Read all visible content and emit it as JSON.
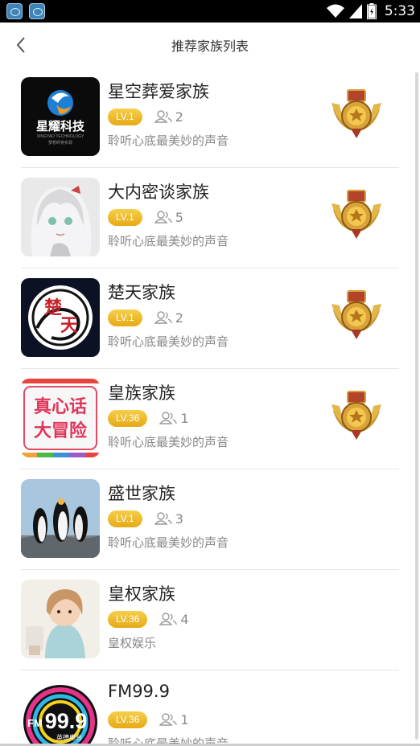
{
  "status": {
    "time": "5:33",
    "icons": [
      "app-icon",
      "app-icon",
      "wifi-icon",
      "signal-icon",
      "battery-icon"
    ]
  },
  "header": {
    "title": "推荐家族列表",
    "back_icon": "chevron-left-icon"
  },
  "families": [
    {
      "name": "星空葬爱家族",
      "level": "LV.1",
      "members": "2",
      "desc": "聆听心底最美妙的声音",
      "medal": true,
      "avatar": "星耀科技 logo"
    },
    {
      "name": "大内密谈家族",
      "level": "LV.1",
      "members": "5",
      "desc": "聆听心底最美妙的声音",
      "medal": true,
      "avatar": "anime girl"
    },
    {
      "name": "楚天家族",
      "level": "LV.1",
      "members": "2",
      "desc": "聆听心底最美妙的声音",
      "medal": true,
      "avatar": "楚天 logo"
    },
    {
      "name": "皇族家族",
      "level": "LV.36",
      "members": "1",
      "desc": "聆听心底最美妙的声音",
      "medal": true,
      "avatar": "真心话大冒险 logo"
    },
    {
      "name": "盛世家族",
      "level": "LV.1",
      "members": "3",
      "desc": "聆听心底最美妙的声音",
      "medal": false,
      "avatar": "penguins"
    },
    {
      "name": "皇权家族",
      "level": "LV.36",
      "members": "4",
      "desc": "皇权娱乐",
      "medal": false,
      "avatar": "girl photo"
    },
    {
      "name": "FM99.9",
      "level": "LV.36",
      "members": "1",
      "desc": "聆听心底最美妙的声音",
      "medal": false,
      "avatar": "FM 99.9 logo"
    }
  ],
  "avatar_text": {
    "a1_title": "星耀科技",
    "a1_sub": "XINGYAO TECHNOLOGY",
    "a1_sub2": "梦想终将实现",
    "a3_c1": "楚",
    "a3_c2": "天",
    "a4_l1": "真心话",
    "a4_l2": "大冒险",
    "a7_big": "99.9",
    "a7_fm": "FM",
    "a7_sub": "英德电台"
  },
  "colors": {
    "level_badge": "#e9ad1c",
    "statusbar": "#000000",
    "divider": "#e6e6e6"
  }
}
